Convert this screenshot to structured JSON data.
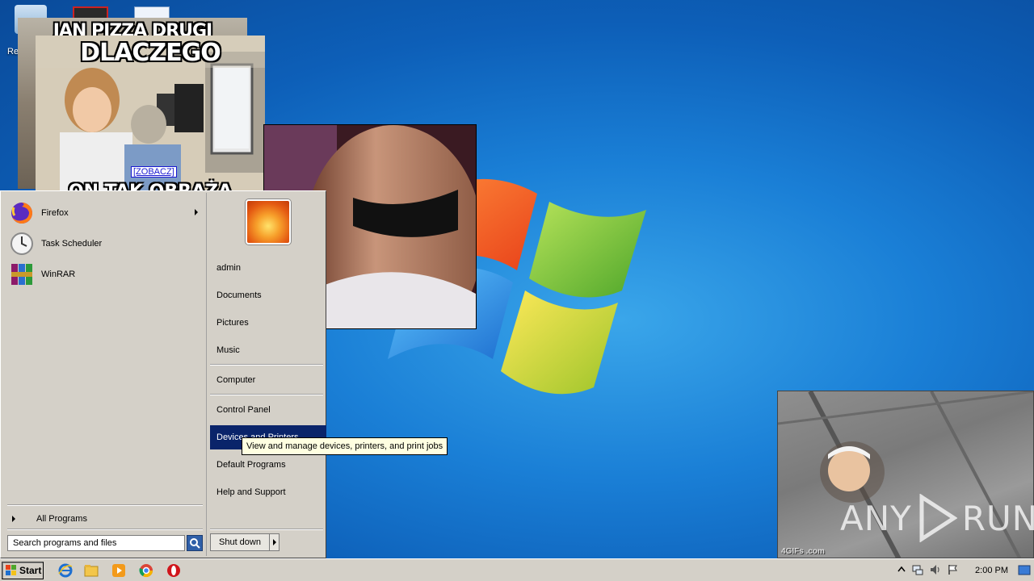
{
  "popups": {
    "meme_back_title": "JAN PIZZA DRUGI",
    "meme_title": "DLACZEGO",
    "meme_bottom": "ON TAK OBRAŻA",
    "meme_link": "[ZOBACZ]",
    "gif_tag": "4GIFs .com"
  },
  "watermark": {
    "left": "ANY",
    "right": "RUN"
  },
  "desktop": {
    "recycle_label": "Re"
  },
  "start_menu": {
    "programs": [
      {
        "label": "Firefox",
        "icon": "firefox-icon",
        "has_submenu": true
      },
      {
        "label": "Task Scheduler",
        "icon": "clock-icon",
        "has_submenu": false
      },
      {
        "label": "WinRAR",
        "icon": "winrar-icon",
        "has_submenu": false
      }
    ],
    "all_programs": "All Programs",
    "search_placeholder": "Search programs and files",
    "places": [
      {
        "label": "admin"
      },
      {
        "label": "Documents"
      },
      {
        "label": "Pictures"
      },
      {
        "label": "Music"
      },
      {
        "label": "Computer"
      },
      {
        "label": "Control Panel"
      },
      {
        "label": "Devices and Printers",
        "highlighted": true
      },
      {
        "label": "Default Programs"
      },
      {
        "label": "Help and Support"
      }
    ],
    "shutdown": "Shut down"
  },
  "tooltip": "View and manage devices, printers, and print jobs",
  "taskbar": {
    "start_label": "Start",
    "pinned": [
      "internet-explorer-icon",
      "explorer-folder-icon",
      "media-player-icon",
      "chrome-icon",
      "opera-icon"
    ],
    "clock": "2:00 PM"
  }
}
